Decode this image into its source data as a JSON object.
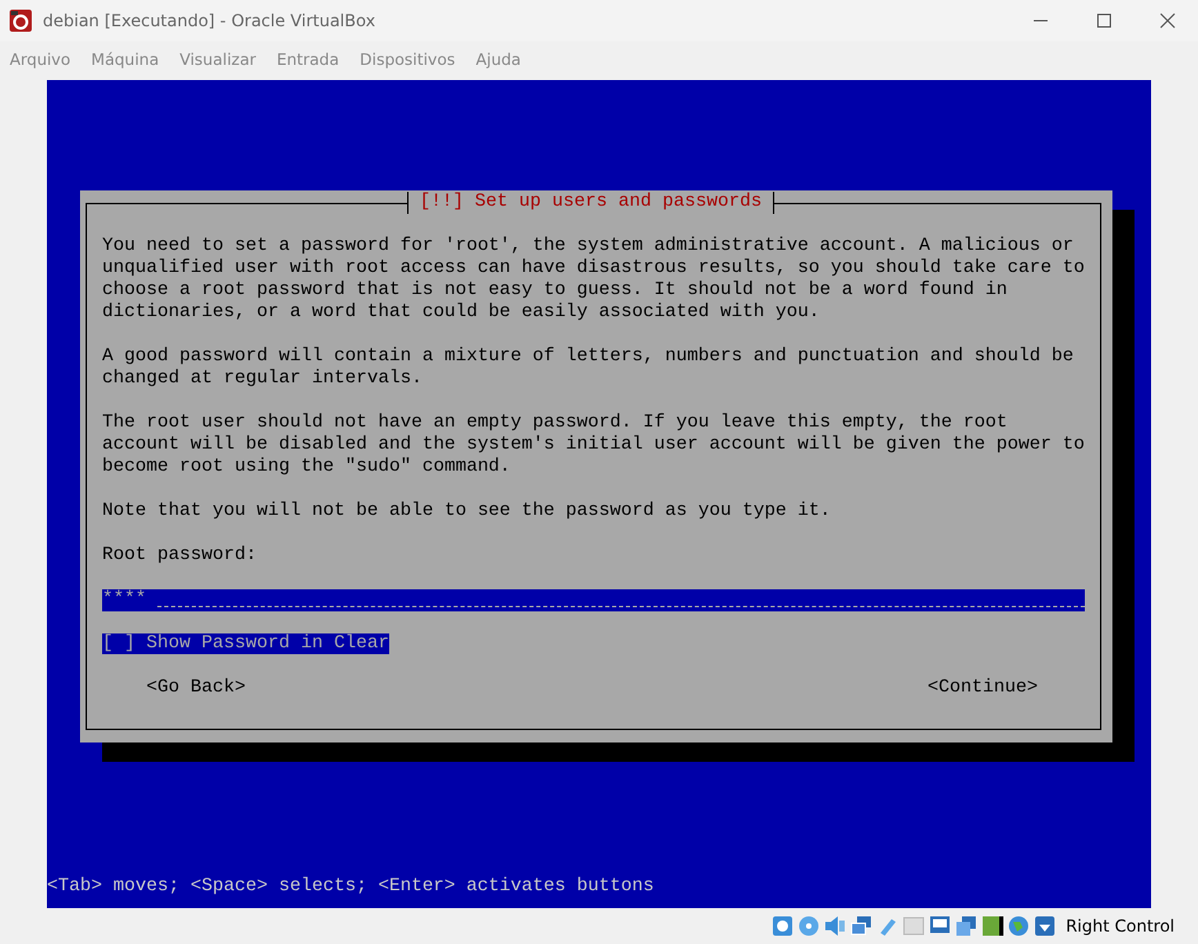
{
  "window": {
    "title": "debian [Executando] - Oracle VirtualBox"
  },
  "menu": [
    "Arquivo",
    "Máquina",
    "Visualizar",
    "Entrada",
    "Dispositivos",
    "Ajuda"
  ],
  "dialog": {
    "title": "[!!] Set up users and passwords",
    "paragraphs": [
      "You need to set a password for 'root', the system administrative account. A malicious or unqualified user with root access can have disastrous results, so you should take care to choose a root password that is not easy to guess. It should not be a word found in dictionaries, or a word that could be easily associated with you.",
      "A good password will contain a mixture of letters, numbers and punctuation and should be changed at regular intervals.",
      "The root user should not have an empty password. If you leave this empty, the root account will be disabled and the system's initial user account will be given the power to become root using the \"sudo\" command.",
      "Note that you will not be able to see the password as you type it."
    ],
    "field_label": "Root password:",
    "password": {
      "value": "****"
    },
    "checkbox": {
      "box": "[ ]",
      "label": "Show Password in Clear",
      "checked": false,
      "focused": true
    },
    "buttons": [
      {
        "label": "<Go Back>"
      },
      {
        "label": "<Continue>"
      }
    ]
  },
  "hint": "<Tab> moves; <Space> selects; <Enter> activates buttons",
  "status_bar": {
    "host_key": "Right Control"
  }
}
